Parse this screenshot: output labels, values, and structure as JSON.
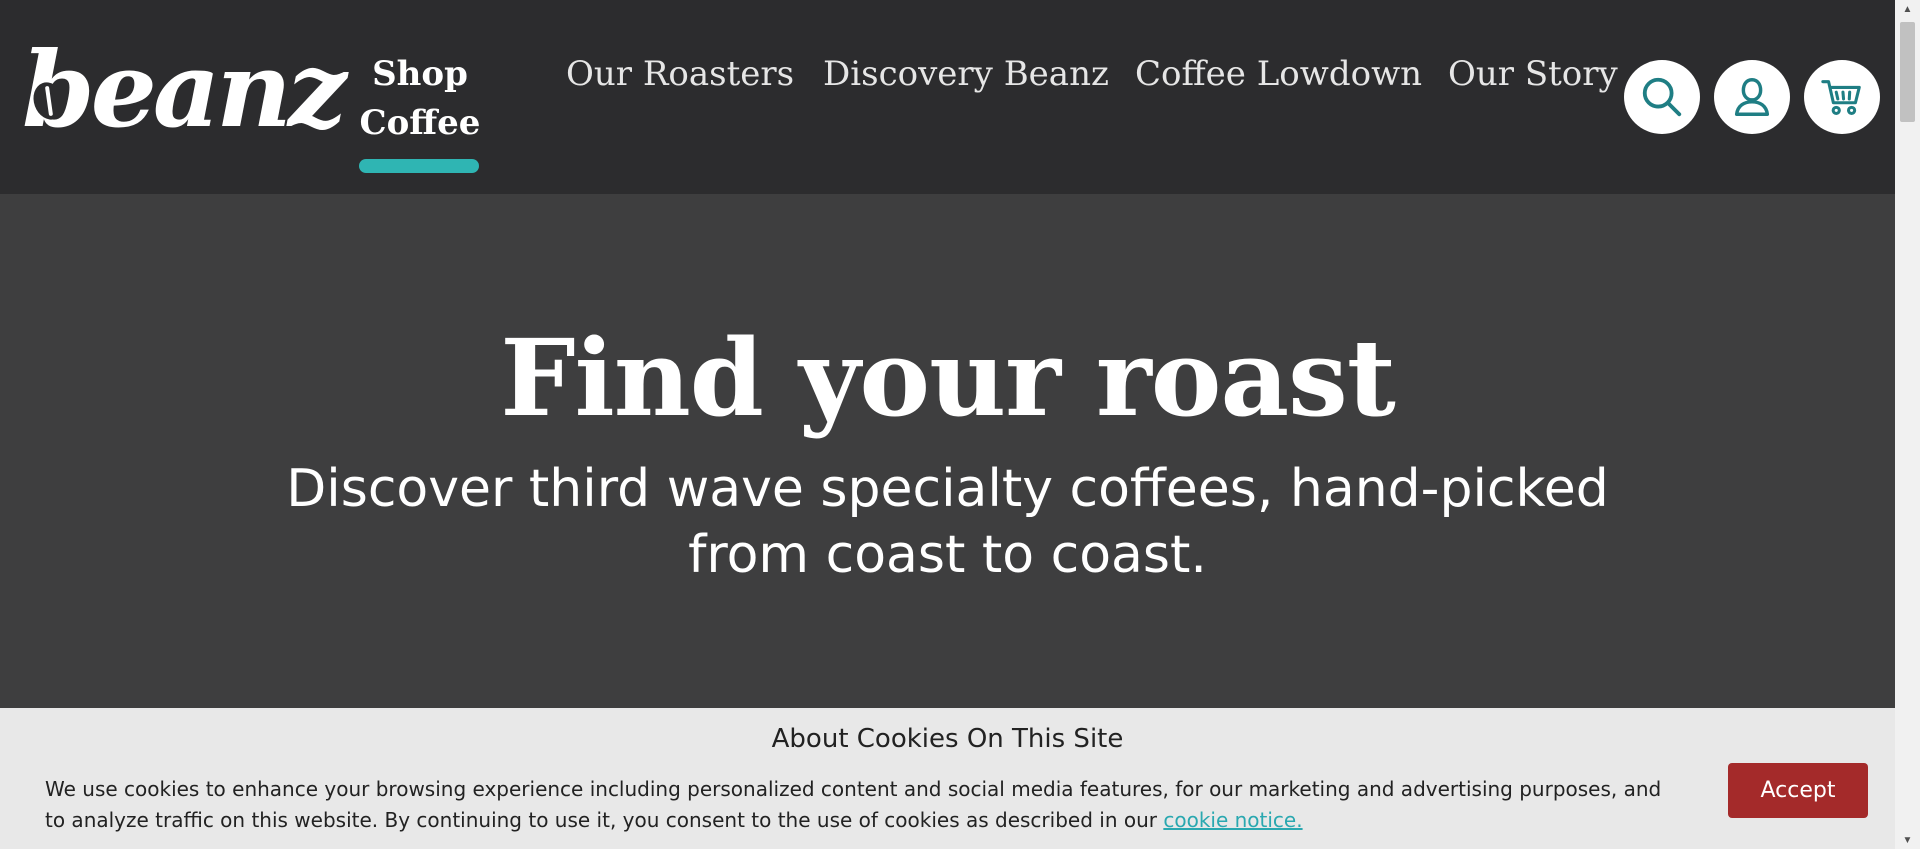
{
  "brand": {
    "logo_text": "beanz"
  },
  "nav": {
    "items": [
      {
        "label": "Shop Coffee",
        "active": true
      },
      {
        "label": "Our Roasters"
      },
      {
        "label": "Discovery Beanz"
      },
      {
        "label": "Coffee Lowdown"
      },
      {
        "label": "Our Story"
      }
    ]
  },
  "header_icons": [
    "search-icon",
    "user-icon",
    "cart-icon"
  ],
  "hero": {
    "title": "Find your roast",
    "subtitle": "Discover third wave specialty coffees, hand-picked from coast to coast."
  },
  "cookie_banner": {
    "title": "About Cookies On This Site",
    "text": "We use cookies to enhance your browsing experience including personalized content and social media features, for our marketing and advertising purposes, and to analyze traffic on this website. By continuing to use it, you consent to the use of cookies as described in our",
    "link_text": "cookie notice.",
    "accept_label": "Accept"
  },
  "colors": {
    "header_bg": "#2c2c2e",
    "hero_bg": "#3e3e3f",
    "accent_teal": "#2fb5b3",
    "accept_red": "#a42a2a",
    "banner_bg": "#e8e8e8"
  }
}
